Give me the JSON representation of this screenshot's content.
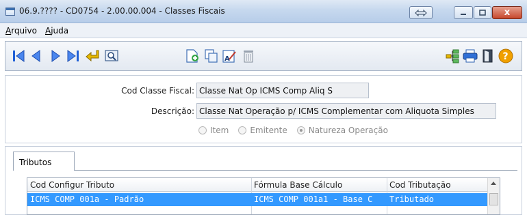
{
  "window": {
    "title": "06.9.???? - CD0754 - 2.00.00.004 - Classes Fiscais",
    "close_label": "x"
  },
  "menu": {
    "items": [
      {
        "label": "Arquivo",
        "mnemonic": "A",
        "rest": "rquivo"
      },
      {
        "label": "Ajuda",
        "mnemonic": "A",
        "rest": "juda"
      }
    ]
  },
  "toolbar": {
    "icons": [
      "first-record-icon",
      "previous-record-icon",
      "next-record-icon",
      "last-record-icon",
      "go-to-icon",
      "search-icon",
      "new-record-icon",
      "copy-record-icon",
      "edit-record-icon",
      "delete-record-icon",
      "tree-icon",
      "print-icon",
      "exit-icon",
      "help-icon"
    ],
    "help_label": "?"
  },
  "form": {
    "cod_label": "Cod Classe Fiscal:",
    "cod_value": "Classe Nat Op ICMS Comp Aliq S",
    "desc_label": "Descrição:",
    "desc_value": "Classe Nat Operação p/ ICMS Complementar com Aliquota Simples",
    "radios": [
      {
        "label": "Item",
        "checked": false
      },
      {
        "label": "Emitente",
        "checked": false
      },
      {
        "label": "Natureza Operação",
        "checked": true
      }
    ]
  },
  "tabs": [
    {
      "label": "Tributos"
    }
  ],
  "grid": {
    "columns": [
      "Cod Configur Tributo",
      "Fórmula Base Cálculo",
      "Cod Tributação"
    ],
    "rows": [
      [
        "ICMS COMP 001a - Padrão",
        "ICMS COMP 001a1 - Base C",
        "Tributado"
      ]
    ]
  },
  "colors": {
    "selection": "#3399ff",
    "nav_arrow": "#1f5fd6",
    "help": "#f0a000"
  }
}
